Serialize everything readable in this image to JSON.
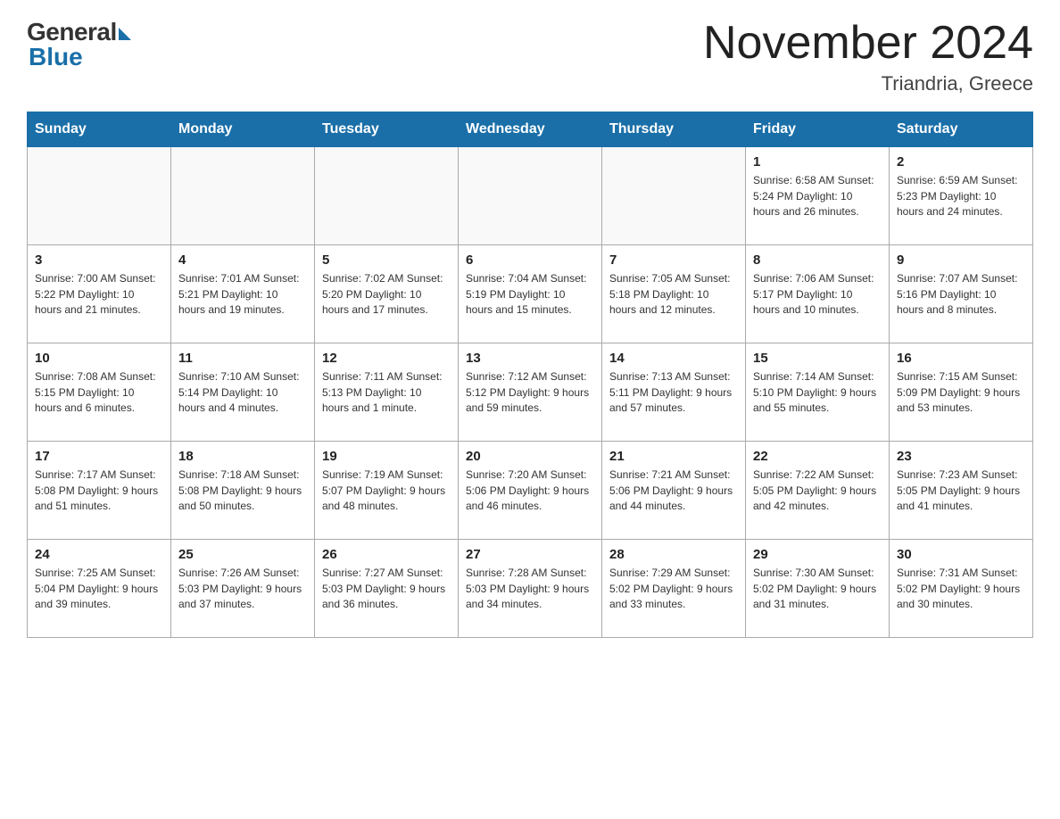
{
  "header": {
    "logo_general": "General",
    "logo_blue": "Blue",
    "month_title": "November 2024",
    "location": "Triandria, Greece"
  },
  "weekdays": [
    "Sunday",
    "Monday",
    "Tuesday",
    "Wednesday",
    "Thursday",
    "Friday",
    "Saturday"
  ],
  "weeks": [
    [
      {
        "day": "",
        "info": ""
      },
      {
        "day": "",
        "info": ""
      },
      {
        "day": "",
        "info": ""
      },
      {
        "day": "",
        "info": ""
      },
      {
        "day": "",
        "info": ""
      },
      {
        "day": "1",
        "info": "Sunrise: 6:58 AM\nSunset: 5:24 PM\nDaylight: 10 hours and 26 minutes."
      },
      {
        "day": "2",
        "info": "Sunrise: 6:59 AM\nSunset: 5:23 PM\nDaylight: 10 hours and 24 minutes."
      }
    ],
    [
      {
        "day": "3",
        "info": "Sunrise: 7:00 AM\nSunset: 5:22 PM\nDaylight: 10 hours and 21 minutes."
      },
      {
        "day": "4",
        "info": "Sunrise: 7:01 AM\nSunset: 5:21 PM\nDaylight: 10 hours and 19 minutes."
      },
      {
        "day": "5",
        "info": "Sunrise: 7:02 AM\nSunset: 5:20 PM\nDaylight: 10 hours and 17 minutes."
      },
      {
        "day": "6",
        "info": "Sunrise: 7:04 AM\nSunset: 5:19 PM\nDaylight: 10 hours and 15 minutes."
      },
      {
        "day": "7",
        "info": "Sunrise: 7:05 AM\nSunset: 5:18 PM\nDaylight: 10 hours and 12 minutes."
      },
      {
        "day": "8",
        "info": "Sunrise: 7:06 AM\nSunset: 5:17 PM\nDaylight: 10 hours and 10 minutes."
      },
      {
        "day": "9",
        "info": "Sunrise: 7:07 AM\nSunset: 5:16 PM\nDaylight: 10 hours and 8 minutes."
      }
    ],
    [
      {
        "day": "10",
        "info": "Sunrise: 7:08 AM\nSunset: 5:15 PM\nDaylight: 10 hours and 6 minutes."
      },
      {
        "day": "11",
        "info": "Sunrise: 7:10 AM\nSunset: 5:14 PM\nDaylight: 10 hours and 4 minutes."
      },
      {
        "day": "12",
        "info": "Sunrise: 7:11 AM\nSunset: 5:13 PM\nDaylight: 10 hours and 1 minute."
      },
      {
        "day": "13",
        "info": "Sunrise: 7:12 AM\nSunset: 5:12 PM\nDaylight: 9 hours and 59 minutes."
      },
      {
        "day": "14",
        "info": "Sunrise: 7:13 AM\nSunset: 5:11 PM\nDaylight: 9 hours and 57 minutes."
      },
      {
        "day": "15",
        "info": "Sunrise: 7:14 AM\nSunset: 5:10 PM\nDaylight: 9 hours and 55 minutes."
      },
      {
        "day": "16",
        "info": "Sunrise: 7:15 AM\nSunset: 5:09 PM\nDaylight: 9 hours and 53 minutes."
      }
    ],
    [
      {
        "day": "17",
        "info": "Sunrise: 7:17 AM\nSunset: 5:08 PM\nDaylight: 9 hours and 51 minutes."
      },
      {
        "day": "18",
        "info": "Sunrise: 7:18 AM\nSunset: 5:08 PM\nDaylight: 9 hours and 50 minutes."
      },
      {
        "day": "19",
        "info": "Sunrise: 7:19 AM\nSunset: 5:07 PM\nDaylight: 9 hours and 48 minutes."
      },
      {
        "day": "20",
        "info": "Sunrise: 7:20 AM\nSunset: 5:06 PM\nDaylight: 9 hours and 46 minutes."
      },
      {
        "day": "21",
        "info": "Sunrise: 7:21 AM\nSunset: 5:06 PM\nDaylight: 9 hours and 44 minutes."
      },
      {
        "day": "22",
        "info": "Sunrise: 7:22 AM\nSunset: 5:05 PM\nDaylight: 9 hours and 42 minutes."
      },
      {
        "day": "23",
        "info": "Sunrise: 7:23 AM\nSunset: 5:05 PM\nDaylight: 9 hours and 41 minutes."
      }
    ],
    [
      {
        "day": "24",
        "info": "Sunrise: 7:25 AM\nSunset: 5:04 PM\nDaylight: 9 hours and 39 minutes."
      },
      {
        "day": "25",
        "info": "Sunrise: 7:26 AM\nSunset: 5:03 PM\nDaylight: 9 hours and 37 minutes."
      },
      {
        "day": "26",
        "info": "Sunrise: 7:27 AM\nSunset: 5:03 PM\nDaylight: 9 hours and 36 minutes."
      },
      {
        "day": "27",
        "info": "Sunrise: 7:28 AM\nSunset: 5:03 PM\nDaylight: 9 hours and 34 minutes."
      },
      {
        "day": "28",
        "info": "Sunrise: 7:29 AM\nSunset: 5:02 PM\nDaylight: 9 hours and 33 minutes."
      },
      {
        "day": "29",
        "info": "Sunrise: 7:30 AM\nSunset: 5:02 PM\nDaylight: 9 hours and 31 minutes."
      },
      {
        "day": "30",
        "info": "Sunrise: 7:31 AM\nSunset: 5:02 PM\nDaylight: 9 hours and 30 minutes."
      }
    ]
  ]
}
